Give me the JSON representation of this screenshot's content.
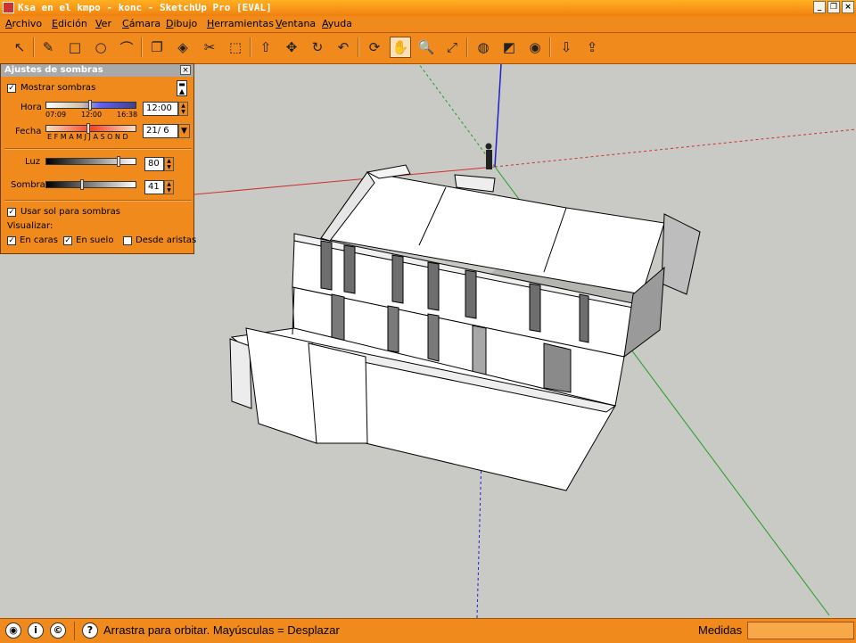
{
  "window": {
    "title": "Ksa en el kmpo - konc - SketchUp Pro [EVAL]"
  },
  "menu": [
    "Archivo",
    "Edición",
    "Ver",
    "Cámara",
    "Dibujo",
    "Herramientas",
    "Ventana",
    "Ayuda"
  ],
  "toolbar": {
    "tools": [
      "select-icon",
      "pencil-icon",
      "rectangle-icon",
      "circle-icon",
      "arc-icon",
      "make-component-icon",
      "eraser-icon",
      "tape-measure-icon",
      "paint-bucket-icon",
      "push-pull-icon",
      "move-icon",
      "rotate-icon",
      "offset-icon",
      "orbit-icon",
      "pan-icon",
      "zoom-icon",
      "zoom-extents-icon",
      "get-models-icon",
      "share-model-icon",
      "google-earth-icon",
      "import-icon",
      "export-icon"
    ],
    "glyphs": [
      "↖",
      "✎",
      "□",
      "○",
      "⌒",
      "❐",
      "◈",
      "✂",
      "⬚",
      "⇧",
      "✥",
      "↻",
      "↶",
      "⟳",
      "✋",
      "🔍",
      "⤢",
      "◍",
      "◩",
      "◉",
      "⇩",
      "⇪"
    ]
  },
  "shadow_panel": {
    "title": "Ajustes de sombras",
    "show_shadows_label": "Mostrar sombras",
    "show_shadows_checked": true,
    "hora_label": "Hora",
    "hora_ticks": [
      "07:09",
      "12:00",
      "16:38"
    ],
    "hora_value": "12:00",
    "fecha_label": "Fecha",
    "fecha_months": "E F M A M J J A S O N D",
    "fecha_value": "21/ 6",
    "luz_label": "Luz",
    "luz_value": "80",
    "sombra_label": "Sombra",
    "sombra_value": "41",
    "use_sun_label": "Usar sol para sombras",
    "use_sun_checked": true,
    "visualize_label": "Visualizar:",
    "en_caras_label": "En caras",
    "en_caras_checked": true,
    "en_suelo_label": "En suelo",
    "en_suelo_checked": true,
    "desde_aristas_label": "Desde aristas",
    "desde_aristas_checked": false
  },
  "status": {
    "hint": "Arrastra para orbitar. Mayúsculas = Desplazar",
    "measure_label": "Medidas",
    "measure_value": ""
  },
  "colors": {
    "accent": "#f08a1c",
    "viewport": "#c9c9c5",
    "axis_red": "#d03030",
    "axis_green": "#20a020",
    "axis_blue": "#2020d0"
  }
}
